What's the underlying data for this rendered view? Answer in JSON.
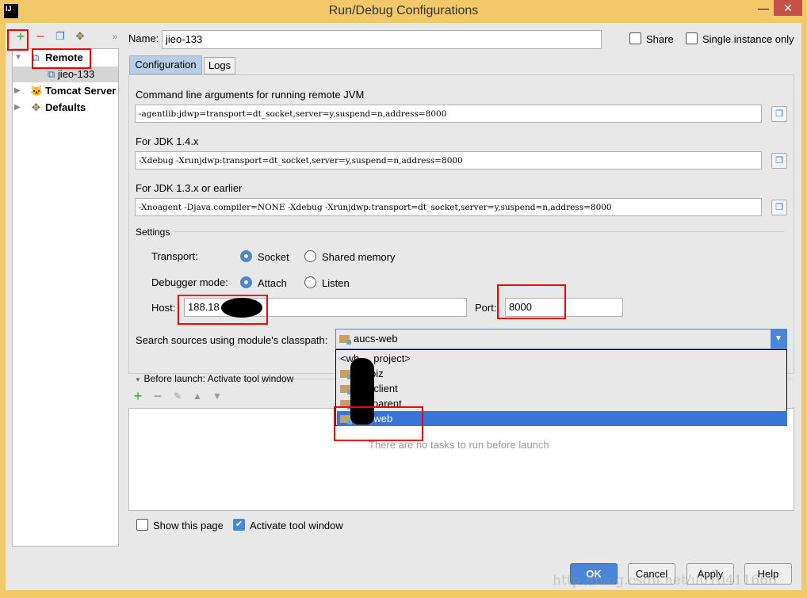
{
  "window": {
    "title": "Run/Debug Configurations",
    "logo": "IJ",
    "controls": [
      "minimize",
      "close"
    ]
  },
  "toolbar": {
    "add": "+",
    "remove": "−",
    "more": "»",
    "icons": [
      "plus-icon",
      "minus-icon",
      "copy-icon",
      "wrench-icon",
      "chevron-double-right-icon"
    ]
  },
  "tree": {
    "items": [
      {
        "label": "Remote",
        "expanded": true
      },
      {
        "label": "jieo-133",
        "selected": true
      },
      {
        "label": "Tomcat Server"
      },
      {
        "label": "Defaults"
      }
    ]
  },
  "name": {
    "label": "Name:",
    "value": "jieo-133"
  },
  "share": {
    "label": "Share",
    "checked": false
  },
  "single": {
    "label": "Single instance only",
    "checked": false
  },
  "tabs": [
    "Configuration",
    "Logs"
  ],
  "config": {
    "cmd_label": "Command line arguments for running remote JVM",
    "cmd_value": "-agentlib:jdwp=transport=dt_socket,server=y,suspend=n,address=8000",
    "jdk14_label": "For JDK 1.4.x",
    "jdk14_value": "-Xdebug -Xrunjdwp:transport=dt_socket,server=y,suspend=n,address=8000",
    "jdk13_label": "For JDK 1.3.x or earlier",
    "jdk13_value": "-Xnoagent -Djava.compiler=NONE -Xdebug -Xrunjdwp:transport=dt_socket,server=y,suspend=n,address=8000",
    "settings_label": "Settings",
    "transport_label": "Transport:",
    "transport_options": [
      "Socket",
      "Shared memory"
    ],
    "transport_selected": "Socket",
    "mode_label": "Debugger mode:",
    "mode_options": [
      "Attach",
      "Listen"
    ],
    "mode_selected": "Attach",
    "host_label": "Host:",
    "host_value": "188.18",
    "port_label": "Port:",
    "port_value": "8000",
    "classpath_label": "Search sources using module's classpath:",
    "classpath_value": "aucs-web",
    "dropdown_items": [
      "<wh",
      "project>",
      "biz",
      "-client",
      "s-parent",
      "-web"
    ]
  },
  "before_launch": {
    "label": "Before launch: Activate tool window",
    "empty": "There are no tasks to run before launch",
    "icons": [
      "plus-icon",
      "minus-icon",
      "pencil-icon",
      "arrow-up-icon",
      "arrow-down-icon"
    ]
  },
  "show_page": {
    "label": "Show this page",
    "checked": false
  },
  "activate": {
    "label": "Activate tool window",
    "checked": true
  },
  "buttons": {
    "ok": "OK",
    "cancel": "Cancel",
    "apply": "Apply",
    "help": "Help"
  },
  "watermark": "http://blog.csdn.net/u010411666",
  "colors": {
    "accent": "#4a85d8",
    "selection": "#3875d7",
    "titlebar": "#f2c869",
    "annotation": "#ff0000"
  }
}
